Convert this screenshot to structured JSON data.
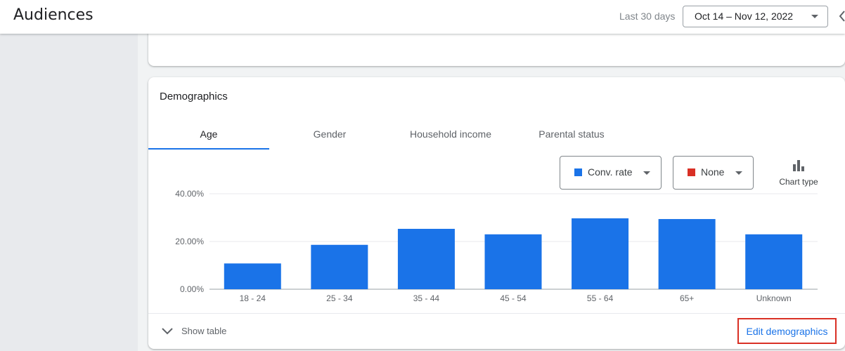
{
  "header": {
    "title": "Audiences",
    "range_label": "Last 30 days",
    "date_range": "Oct 14 – Nov 12, 2022"
  },
  "card": {
    "title": "Demographics",
    "tabs": [
      {
        "label": "Age"
      },
      {
        "label": "Gender"
      },
      {
        "label": "Household income"
      },
      {
        "label": "Parental status"
      }
    ],
    "active_tab": "Age",
    "metric_primary": {
      "label": "Conv. rate",
      "color": "#1a73e8"
    },
    "metric_secondary": {
      "label": "None",
      "color": "#d93025"
    },
    "chart_type_label": "Chart type",
    "show_table_label": "Show table",
    "edit_link_label": "Edit demographics"
  },
  "chart_data": {
    "type": "bar",
    "categories": [
      "18 - 24",
      "25 - 34",
      "35 - 44",
      "45 - 54",
      "55 - 64",
      "65+",
      "Unknown"
    ],
    "values": [
      10.8,
      18.6,
      25.3,
      23.0,
      29.7,
      29.4,
      23.0
    ],
    "y_ticks": [
      "0.00%",
      "20.00%",
      "40.00%"
    ],
    "ylim": [
      0,
      40
    ],
    "bar_color": "#1a73e8",
    "grid": true
  }
}
